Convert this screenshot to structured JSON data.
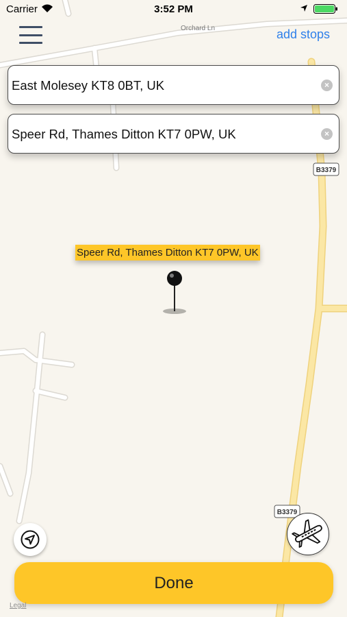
{
  "status_bar": {
    "carrier": "Carrier",
    "time": "3:52 PM"
  },
  "header": {
    "add_stops_label": "add stops"
  },
  "route": {
    "origin": "East Molesey KT8 0BT, UK",
    "destination": "Speer Rd, Thames Ditton KT7 0PW, UK"
  },
  "map": {
    "street_label": "Orchard Ln",
    "road_badges": [
      "B3379",
      "B3379"
    ],
    "pin_label": "Speer Rd, Thames Ditton KT7 0PW, UK",
    "legal_label": "Legal"
  },
  "actions": {
    "done_label": "Done"
  },
  "colors": {
    "accent": "#fec628",
    "link": "#2f80ea",
    "map_bg": "#f8f5ee",
    "major_road": "#fbe7a5"
  }
}
